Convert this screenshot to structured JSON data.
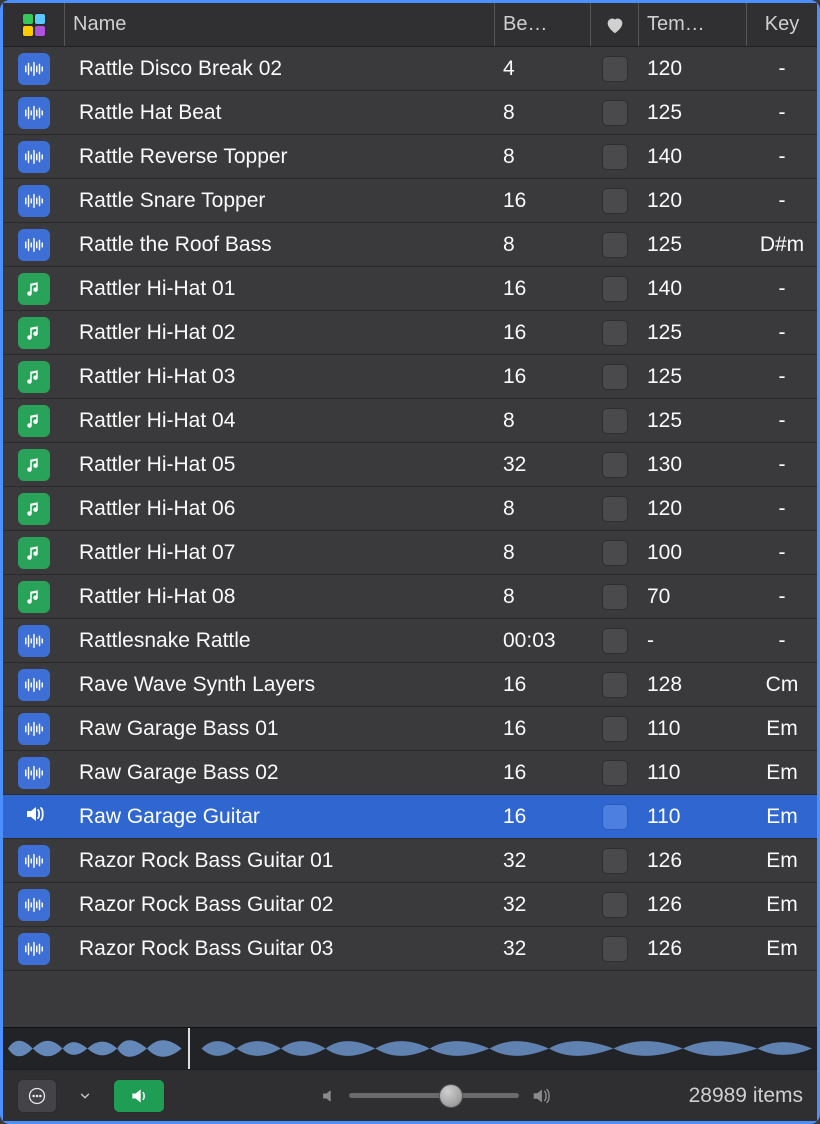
{
  "header": {
    "name": "Name",
    "beats": "Be…",
    "tempo": "Tem…",
    "key": "Key"
  },
  "rows": [
    {
      "type": "audio",
      "name": "Rattle Disco Break 02",
      "beats": "4",
      "tempo": "120",
      "key": "-"
    },
    {
      "type": "audio",
      "name": "Rattle Hat Beat",
      "beats": "8",
      "tempo": "125",
      "key": "-"
    },
    {
      "type": "audio",
      "name": "Rattle Reverse Topper",
      "beats": "8",
      "tempo": "140",
      "key": "-"
    },
    {
      "type": "audio",
      "name": "Rattle Snare Topper",
      "beats": "16",
      "tempo": "120",
      "key": "-"
    },
    {
      "type": "audio",
      "name": "Rattle the Roof Bass",
      "beats": "8",
      "tempo": "125",
      "key": "D#m"
    },
    {
      "type": "midi",
      "name": "Rattler Hi-Hat 01",
      "beats": "16",
      "tempo": "140",
      "key": "-"
    },
    {
      "type": "midi",
      "name": "Rattler Hi-Hat 02",
      "beats": "16",
      "tempo": "125",
      "key": "-"
    },
    {
      "type": "midi",
      "name": "Rattler Hi-Hat 03",
      "beats": "16",
      "tempo": "125",
      "key": "-"
    },
    {
      "type": "midi",
      "name": "Rattler Hi-Hat 04",
      "beats": "8",
      "tempo": "125",
      "key": "-"
    },
    {
      "type": "midi",
      "name": "Rattler Hi-Hat 05",
      "beats": "32",
      "tempo": "130",
      "key": "-"
    },
    {
      "type": "midi",
      "name": "Rattler Hi-Hat 06",
      "beats": "8",
      "tempo": "120",
      "key": "-"
    },
    {
      "type": "midi",
      "name": "Rattler Hi-Hat 07",
      "beats": "8",
      "tempo": "100",
      "key": "-"
    },
    {
      "type": "midi",
      "name": "Rattler Hi-Hat 08",
      "beats": "8",
      "tempo": "70",
      "key": "-"
    },
    {
      "type": "audio",
      "name": "Rattlesnake Rattle",
      "beats": "00:03",
      "tempo": "-",
      "key": "-"
    },
    {
      "type": "audio",
      "name": "Rave Wave Synth Layers",
      "beats": "16",
      "tempo": "128",
      "key": "Cm"
    },
    {
      "type": "audio",
      "name": "Raw Garage Bass 01",
      "beats": "16",
      "tempo": "110",
      "key": "Em"
    },
    {
      "type": "audio",
      "name": "Raw Garage Bass 02",
      "beats": "16",
      "tempo": "110",
      "key": "Em"
    },
    {
      "type": "playing",
      "name": "Raw Garage Guitar",
      "beats": "16",
      "tempo": "110",
      "key": "Em",
      "selected": true
    },
    {
      "type": "audio",
      "name": "Razor Rock Bass Guitar 01",
      "beats": "32",
      "tempo": "126",
      "key": "Em"
    },
    {
      "type": "audio",
      "name": "Razor Rock Bass Guitar 02",
      "beats": "32",
      "tempo": "126",
      "key": "Em"
    },
    {
      "type": "audio",
      "name": "Razor Rock Bass Guitar 03",
      "beats": "32",
      "tempo": "126",
      "key": "Em"
    }
  ],
  "footer": {
    "count": "28989 items"
  }
}
